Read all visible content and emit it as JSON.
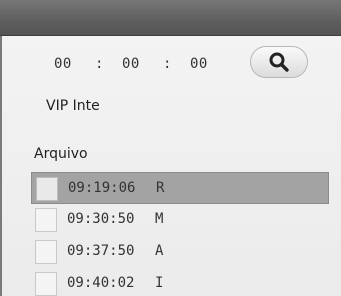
{
  "time_filter": {
    "hours": "00",
    "minutes": "00",
    "seconds": "00",
    "separator": ":"
  },
  "search": {
    "icon": "search-icon"
  },
  "vip_label": "VIP Inte",
  "section_label": "Arquivo",
  "entries": [
    {
      "time": "09:19:06",
      "tag": "R",
      "selected": true,
      "checked": false
    },
    {
      "time": "09:30:50",
      "tag": "M",
      "selected": false,
      "checked": false
    },
    {
      "time": "09:37:50",
      "tag": "A",
      "selected": false,
      "checked": false
    },
    {
      "time": "09:40:02",
      "tag": "I",
      "selected": false,
      "checked": false
    }
  ],
  "colors": {
    "titlebar": "#5e5e5e",
    "panel": "#efefef",
    "selected_row": "#a3a3a3"
  }
}
